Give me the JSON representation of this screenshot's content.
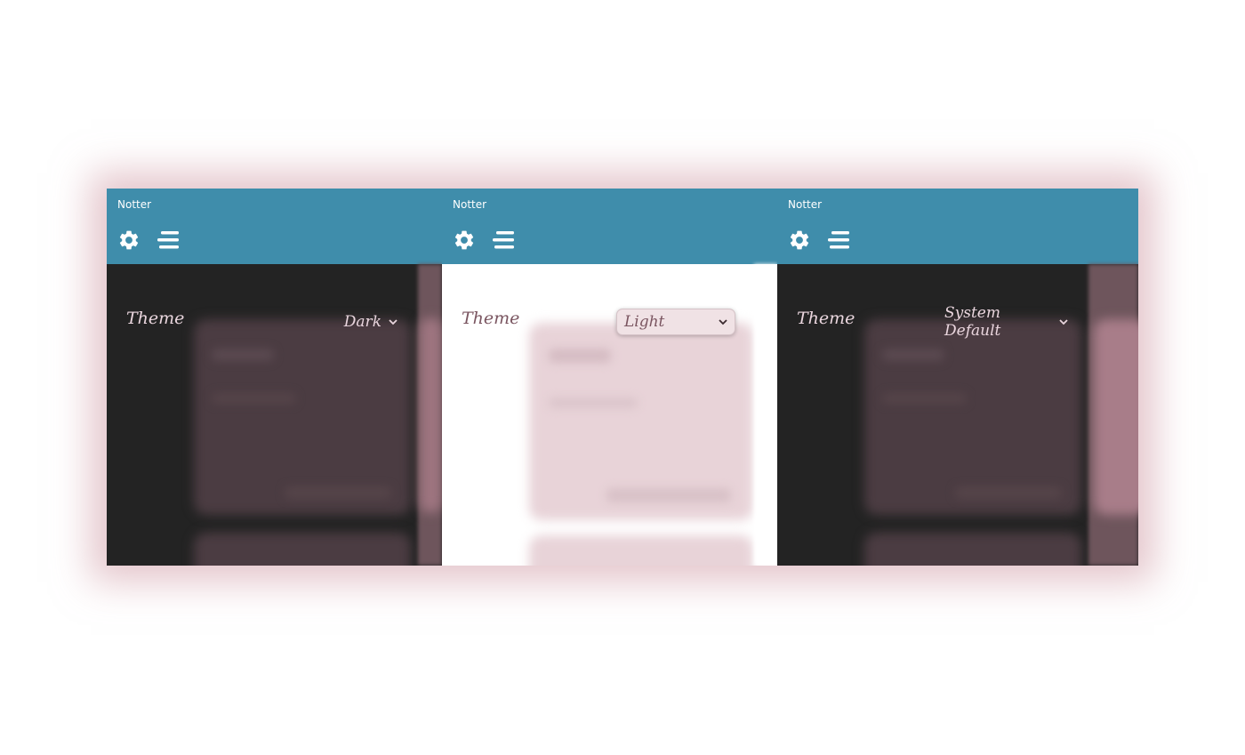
{
  "app": {
    "title": "Notter"
  },
  "icons": {
    "settings": "gear-icon",
    "menu": "menu-lines-icon",
    "dropdown": "chevron-down-icon"
  },
  "colors": {
    "titlebar": "#3f8dab",
    "dark_background": "#232323",
    "light_background": "#ffffff",
    "blurred_card_dark": "#4a3c41",
    "blurred_card_light": "#e8d3d8",
    "accent_pink": "#c58f9c"
  },
  "panels": [
    {
      "theme_label": "Theme",
      "selected_theme": "Dark",
      "mode": "dark"
    },
    {
      "theme_label": "Theme",
      "selected_theme": "Light",
      "mode": "light"
    },
    {
      "theme_label": "Theme",
      "selected_theme": "System Default",
      "mode": "dark"
    }
  ]
}
